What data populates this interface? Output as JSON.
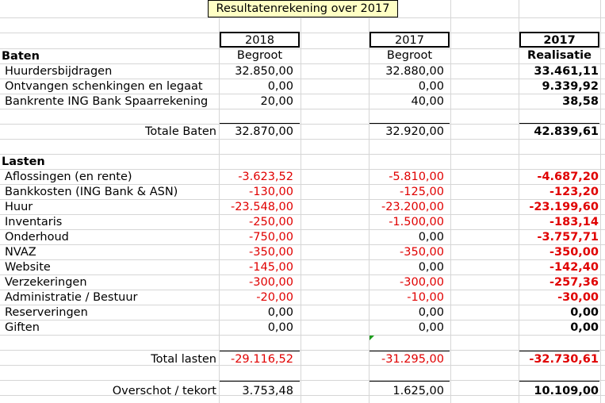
{
  "title": "Resultatenrekening over 2017",
  "headers": {
    "col1_year": "2018",
    "col1_sub": "Begroot",
    "col2_year": "2017",
    "col2_sub": "Begroot",
    "col3_year": "2017",
    "col3_sub": "Realisatie"
  },
  "baten": {
    "section_label": "Baten",
    "rows": [
      {
        "label": "Huurdersbijdragen",
        "v2018": "32.850,00",
        "b2017": "32.880,00",
        "r2017": "33.461,11"
      },
      {
        "label": "Ontvangen schenkingen en legaat",
        "v2018": "0,00",
        "b2017": "0,00",
        "r2017": "9.339,92"
      },
      {
        "label": "Bankrente ING Bank Spaarrekening",
        "v2018": "20,00",
        "b2017": "40,00",
        "r2017": "38,58"
      }
    ],
    "total": {
      "label": "Totale Baten",
      "v2018": "32.870,00",
      "b2017": "32.920,00",
      "r2017": "42.839,61"
    }
  },
  "lasten": {
    "section_label": "Lasten",
    "rows": [
      {
        "label": "Aflossingen (en rente)",
        "v2018": "-3.623,52",
        "b2017": "-5.810,00",
        "r2017": "-4.687,20"
      },
      {
        "label": "Bankkosten (ING Bank & ASN)",
        "v2018": "-130,00",
        "b2017": "-125,00",
        "r2017": "-123,20"
      },
      {
        "label": "Huur",
        "v2018": "-23.548,00",
        "b2017": "-23.200,00",
        "r2017": "-23.199,60"
      },
      {
        "label": "Inventaris",
        "v2018": "-250,00",
        "b2017": "-1.500,00",
        "r2017": "-183,14"
      },
      {
        "label": "Onderhoud",
        "v2018": "-750,00",
        "b2017": "0,00",
        "r2017": "-3.757,71"
      },
      {
        "label": "NVAZ",
        "v2018": "-350,00",
        "b2017": "-350,00",
        "r2017": "-350,00"
      },
      {
        "label": "Website",
        "v2018": "-145,00",
        "b2017": "0,00",
        "r2017": "-142,40"
      },
      {
        "label": "Verzekeringen",
        "v2018": "-300,00",
        "b2017": "-300,00",
        "r2017": "-257,36"
      },
      {
        "label": "Administratie / Bestuur",
        "v2018": "-20,00",
        "b2017": "-10,00",
        "r2017": "-30,00"
      },
      {
        "label": "Reserveringen",
        "v2018": "0,00",
        "b2017": "0,00",
        "r2017": "0,00"
      },
      {
        "label": "Giften",
        "v2018": "0,00",
        "b2017": "0,00",
        "r2017": "0,00"
      }
    ],
    "total": {
      "label": "Total lasten",
      "v2018": "-29.116,52",
      "b2017": "-31.295,00",
      "r2017": "-32.730,61"
    }
  },
  "result": {
    "label": "Overschot / tekort",
    "v2018": "3.753,48",
    "b2017": "1.625,00",
    "r2017": "10.109,00"
  },
  "colors": {
    "negative": "#e00000",
    "title_fill": "#ffffc4",
    "gridline": "#d6d6d6",
    "comment_marker": "#1e9e1e"
  }
}
